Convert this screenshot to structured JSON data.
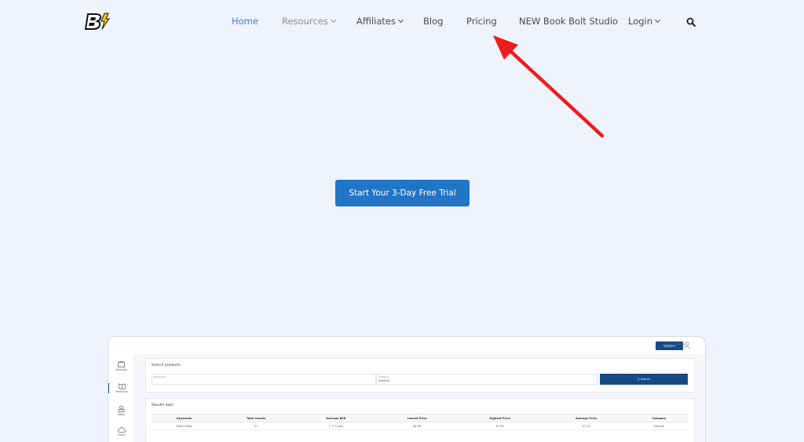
{
  "nav": {
    "items": [
      {
        "label": "Home",
        "dropdown": false
      },
      {
        "label": "Resources",
        "dropdown": true
      },
      {
        "label": "Affiliates",
        "dropdown": true
      },
      {
        "label": "Blog",
        "dropdown": false
      },
      {
        "label": "Pricing",
        "dropdown": false
      },
      {
        "label": "NEW Book Bolt Studio",
        "dropdown": false
      },
      {
        "label": "Login",
        "dropdown": true
      }
    ]
  },
  "hero": {
    "cta_label": "Start Your 3-Day Free Trial"
  },
  "colors": {
    "background": "#eef3fd",
    "nav_active": "#3b82d6",
    "cta": "#2275c4",
    "arrow": "#ee1c1c",
    "dashboard_primary": "#174a84"
  },
  "preview": {
    "top_badge": "Visitors",
    "user_label": "Admin",
    "sidebar": [
      {
        "label": "Tutorials",
        "icon": "tutorials-icon"
      },
      {
        "label": "Products",
        "icon": "book-icon"
      },
      {
        "label": "Sales",
        "icon": "sales-icon"
      },
      {
        "label": "Cloud",
        "icon": "cloud-icon"
      }
    ],
    "search_card": {
      "title": "Search products",
      "keywords_label": "Keywords",
      "keywords_value": "",
      "category_label": "Category",
      "category_value": "General",
      "button_label": "Search"
    },
    "results_card": {
      "title": "Results data",
      "columns": [
        "Keywords",
        "Total results",
        "Average BSR",
        "Lowest Price",
        "Highest Price",
        "Average Price",
        "Category"
      ],
      "rows": [
        [
          "Glass Holes",
          "21",
          "1 775 440",
          "$6.99",
          "$7.95",
          "$7.22",
          "General"
        ]
      ]
    }
  }
}
